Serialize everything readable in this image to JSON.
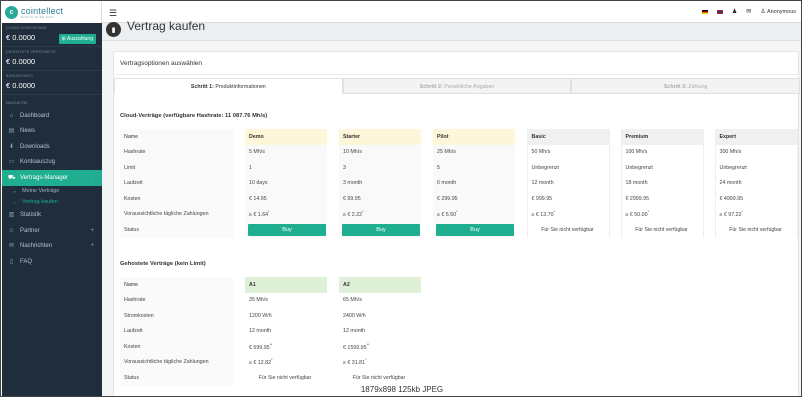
{
  "brand": {
    "name": "cointellect",
    "tagline": "MINING MADE EASY"
  },
  "sidebar": {
    "balances": [
      {
        "label": "CLOUD-KONTOSTAND",
        "value": "€ 0.0000",
        "button": "Auszahlung"
      },
      {
        "label": "GEHOSTETE VERSTÄRKTE",
        "value": "€ 0.0000"
      },
      {
        "label": "BONUSKONTO",
        "value": "€ 0.0000"
      }
    ],
    "nav_heading": "NAVIGATION",
    "items": [
      {
        "label": "Dashboard",
        "icon": "home-icon",
        "glyph": "⌂"
      },
      {
        "label": "News",
        "icon": "newspaper-icon",
        "glyph": "▤"
      },
      {
        "label": "Downloads",
        "icon": "download-icon",
        "glyph": "⬇"
      },
      {
        "label": "Kontoauszug",
        "icon": "statement-icon",
        "glyph": "▭"
      },
      {
        "label": "Vertrags-Manager",
        "icon": "cart-icon",
        "glyph": "⛟",
        "active": true,
        "suffix": "−"
      }
    ],
    "subitems": [
      {
        "label": "Meine Verträge"
      },
      {
        "label": "Vertrag kaufen",
        "active": true
      }
    ],
    "items2": [
      {
        "label": "Statistik",
        "icon": "chart-icon",
        "glyph": "▥"
      },
      {
        "label": "Partner",
        "icon": "users-icon",
        "glyph": "☺",
        "suffix": "+"
      },
      {
        "label": "Nachrichten",
        "icon": "envelope-icon",
        "glyph": "✉",
        "suffix": "+"
      },
      {
        "label": "FAQ",
        "icon": "book-icon",
        "glyph": "▯"
      }
    ]
  },
  "topbar": {
    "user": "Anonymous"
  },
  "page": {
    "title": "Vertrag kaufen"
  },
  "panel": {
    "title": "Vertragsoptionen auswählen",
    "steps": [
      {
        "prefix": "Schritt 1:",
        "label": "Produktinformationen"
      },
      {
        "prefix": "Schritt 2:",
        "label": "Persönliche Angaben"
      },
      {
        "prefix": "Schritt 3:",
        "label": "Zahlung"
      }
    ]
  },
  "cloud": {
    "title": "Cloud-Verträge (verfügbare Hashrate: 11 087.76 Mh/s)",
    "row_labels": [
      "Name",
      "Hashrate",
      "Limit",
      "Laufzeit",
      "Kosten",
      "Voraussichtliche tägliche Zahlungen",
      "Status"
    ],
    "plans": [
      {
        "name": "Demo",
        "hashrate": "5 Mh/s",
        "limit": "1",
        "laufzeit": "10 days",
        "kosten": "€ 14.95",
        "daily": "≥ € 1.64",
        "status": "Buy"
      },
      {
        "name": "Starter",
        "hashrate": "10 Mh/s",
        "limit": "3",
        "laufzeit": "3 month",
        "kosten": "€ 99.95",
        "daily": "≥ € 2.22",
        "status": "Buy"
      },
      {
        "name": "Pilot",
        "hashrate": "25 Mh/s",
        "limit": "5",
        "laufzeit": "6 month",
        "kosten": "€ 299.95",
        "daily": "≥ € 5.50",
        "status": "Buy"
      },
      {
        "name": "Basic",
        "hashrate": "50 Mh/s",
        "limit": "Unbegrenzt",
        "laufzeit": "12 month",
        "kosten": "€ 999.95",
        "daily": "≥ € 13.70",
        "status": "Für Sie nicht verfügbar"
      },
      {
        "name": "Premium",
        "hashrate": "100 Mh/s",
        "limit": "Unbegrenzt",
        "laufzeit": "18 month",
        "kosten": "€ 2999.95",
        "daily": "≥ € 50.00",
        "status": "Für Sie nicht verfügbar"
      },
      {
        "name": "Expert",
        "hashrate": "300 Mh/s",
        "limit": "Unbegrenzt",
        "laufzeit": "24 month",
        "kosten": "€ 4999.95",
        "daily": "≥ € 97.22",
        "status": "Für Sie nicht verfügbar"
      }
    ]
  },
  "hosted": {
    "title": "Gehostete Verträge (kein Limit)",
    "row_labels": [
      "Name",
      "Hashrate",
      "Stromkosten",
      "Laufzeit",
      "Kosten",
      "Voraussichtliche tägliche Zahlungen",
      "Status"
    ],
    "plans": [
      {
        "name": "A1",
        "hashrate": "35 Mh/s",
        "strom": "1200 W/h",
        "laufzeit": "12 month",
        "kosten": "€ 599.95",
        "daily": "≥ € 12.82",
        "status": "Für Sie nicht verfügbar"
      },
      {
        "name": "A2",
        "hashrate": "65 Mh/s",
        "strom": "2400 W/h",
        "laufzeit": "12 month",
        "kosten": "€ 1599.95",
        "daily": "≥ € 31.81",
        "status": "Für Sie nicht verfügbar"
      }
    ]
  },
  "image_info": "1879x898  125kb  JPEG"
}
